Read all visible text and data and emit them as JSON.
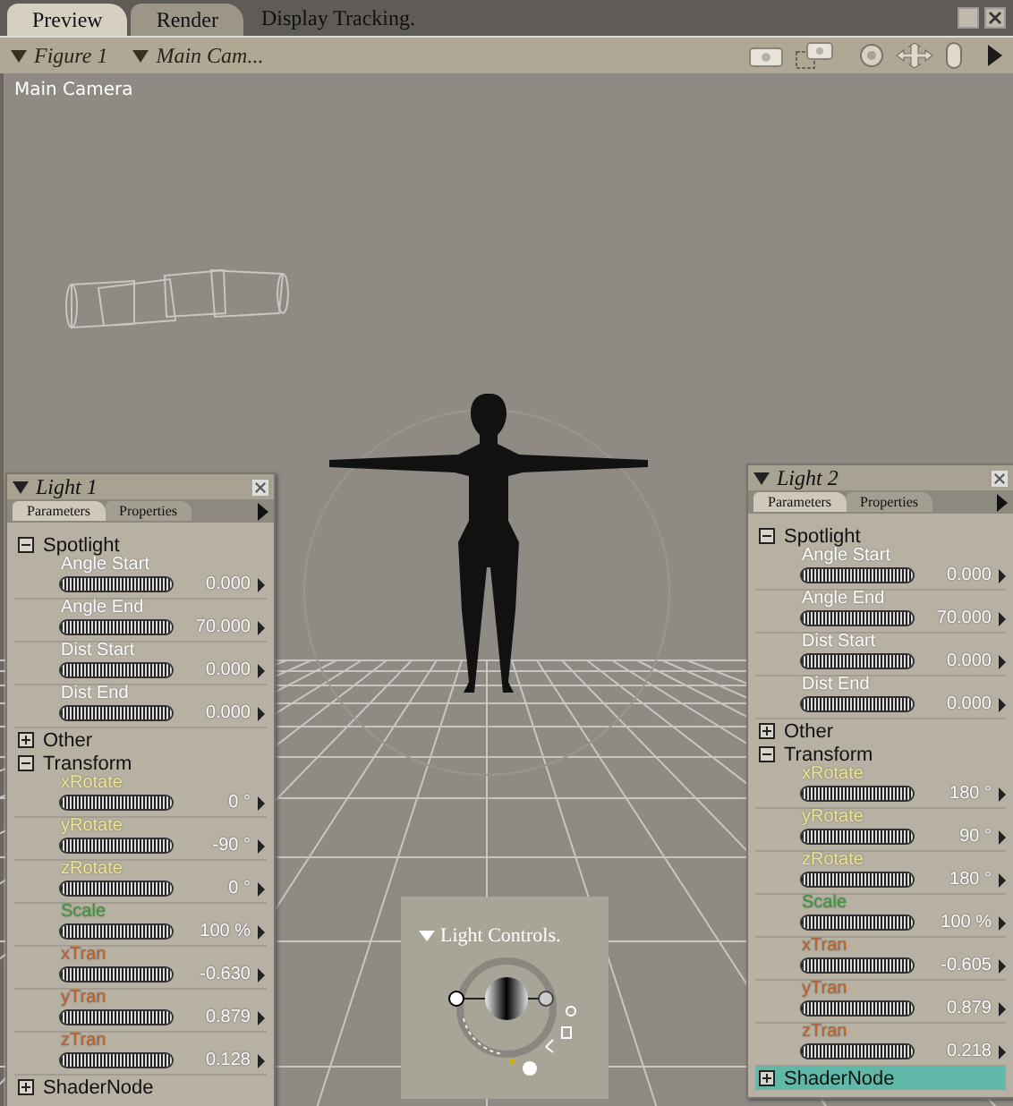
{
  "tabs": [
    {
      "label": "Preview",
      "selected": true
    },
    {
      "label": "Render",
      "selected": false
    }
  ],
  "status": "Display Tracking.",
  "toolbar": {
    "figure_menu": "Figure 1",
    "camera_menu": "Main Cam..."
  },
  "viewport": {
    "camera_label": "Main Camera"
  },
  "panels": [
    {
      "title": "Light 1",
      "tabs": [
        {
          "label": "Parameters",
          "selected": true
        },
        {
          "label": "Properties",
          "selected": false
        }
      ],
      "groups": [
        {
          "label": "Spotlight",
          "expanded": true,
          "selected": false,
          "params": [
            {
              "label": "Angle Start",
              "value": "0.000",
              "color": "#ffffff"
            },
            {
              "label": "Angle End",
              "value": "70.000",
              "color": "#ffffff"
            },
            {
              "label": "Dist Start",
              "value": "0.000",
              "color": "#ffffff"
            },
            {
              "label": "Dist End",
              "value": "0.000",
              "color": "#ffffff"
            }
          ]
        },
        {
          "label": "Other",
          "expanded": false,
          "selected": false
        },
        {
          "label": "Transform",
          "expanded": true,
          "selected": false,
          "params": [
            {
              "label": "xRotate",
              "value": "0 °",
              "color": "#f0e68c"
            },
            {
              "label": "yRotate",
              "value": "-90 °",
              "color": "#f0e68c"
            },
            {
              "label": "zRotate",
              "value": "0 °",
              "color": "#f0e68c"
            },
            {
              "label": "Scale",
              "value": "100 %",
              "color": "#3c9a3c"
            },
            {
              "label": "xTran",
              "value": "-0.630",
              "color": "#c0602a"
            },
            {
              "label": "yTran",
              "value": "0.879",
              "color": "#c0602a"
            },
            {
              "label": "zTran",
              "value": "0.128",
              "color": "#c0602a"
            }
          ]
        },
        {
          "label": "ShaderNode",
          "expanded": false,
          "selected": false
        }
      ]
    },
    {
      "title": "Light 2",
      "tabs": [
        {
          "label": "Parameters",
          "selected": true
        },
        {
          "label": "Properties",
          "selected": false
        }
      ],
      "groups": [
        {
          "label": "Spotlight",
          "expanded": true,
          "selected": false,
          "params": [
            {
              "label": "Angle Start",
              "value": "0.000",
              "color": "#ffffff"
            },
            {
              "label": "Angle End",
              "value": "70.000",
              "color": "#ffffff"
            },
            {
              "label": "Dist Start",
              "value": "0.000",
              "color": "#ffffff"
            },
            {
              "label": "Dist End",
              "value": "0.000",
              "color": "#ffffff"
            }
          ]
        },
        {
          "label": "Other",
          "expanded": false,
          "selected": false
        },
        {
          "label": "Transform",
          "expanded": true,
          "selected": false,
          "params": [
            {
              "label": "xRotate",
              "value": "180 °",
              "color": "#f0e68c"
            },
            {
              "label": "yRotate",
              "value": "90 °",
              "color": "#f0e68c"
            },
            {
              "label": "zRotate",
              "value": "180 °",
              "color": "#f0e68c"
            },
            {
              "label": "Scale",
              "value": "100 %",
              "color": "#3c9a3c"
            },
            {
              "label": "xTran",
              "value": "-0.605",
              "color": "#c0602a"
            },
            {
              "label": "yTran",
              "value": "0.879",
              "color": "#c0602a"
            },
            {
              "label": "zTran",
              "value": "0.218",
              "color": "#c0602a"
            }
          ]
        },
        {
          "label": "ShaderNode",
          "expanded": false,
          "selected": true
        }
      ]
    }
  ],
  "light_controls": {
    "title": "Light Controls."
  }
}
